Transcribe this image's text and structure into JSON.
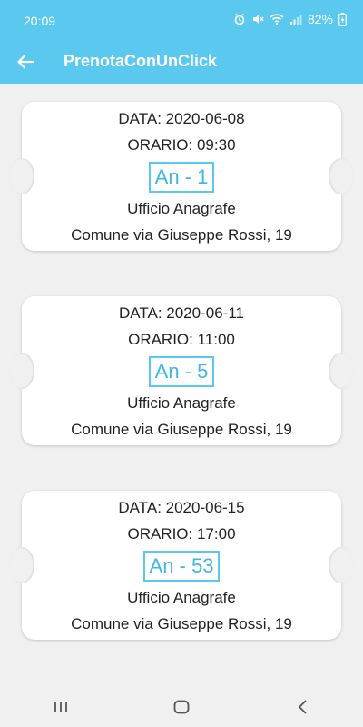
{
  "status_bar": {
    "time": "20:09",
    "battery_percent": "82%",
    "icons": [
      "alarm-icon",
      "mute-icon",
      "wifi-icon",
      "signal-icon",
      "battery-charging-icon"
    ]
  },
  "app_bar": {
    "title": "PrenotaConUnClick",
    "back_icon": "arrow-left-icon"
  },
  "colors": {
    "primary": "#5bc8ef",
    "code_text": "#3fb6e6",
    "background": "#f0f0f0",
    "card": "#ffffff"
  },
  "tickets": [
    {
      "date": "DATA: 2020-06-08",
      "time": "ORARIO: 09:30",
      "code": "An - 1",
      "office": "Ufficio Anagrafe",
      "address": "Comune via Giuseppe Rossi, 19"
    },
    {
      "date": "DATA: 2020-06-11",
      "time": "ORARIO: 11:00",
      "code": "An - 5",
      "office": "Ufficio Anagrafe",
      "address": "Comune via Giuseppe Rossi, 19"
    },
    {
      "date": "DATA: 2020-06-15",
      "time": "ORARIO: 17:00",
      "code": "An - 53",
      "office": "Ufficio Anagrafe",
      "address": "Comune via Giuseppe Rossi, 19"
    }
  ],
  "nav_bar": {
    "icons": [
      "recent-apps-icon",
      "home-icon",
      "back-icon"
    ]
  }
}
